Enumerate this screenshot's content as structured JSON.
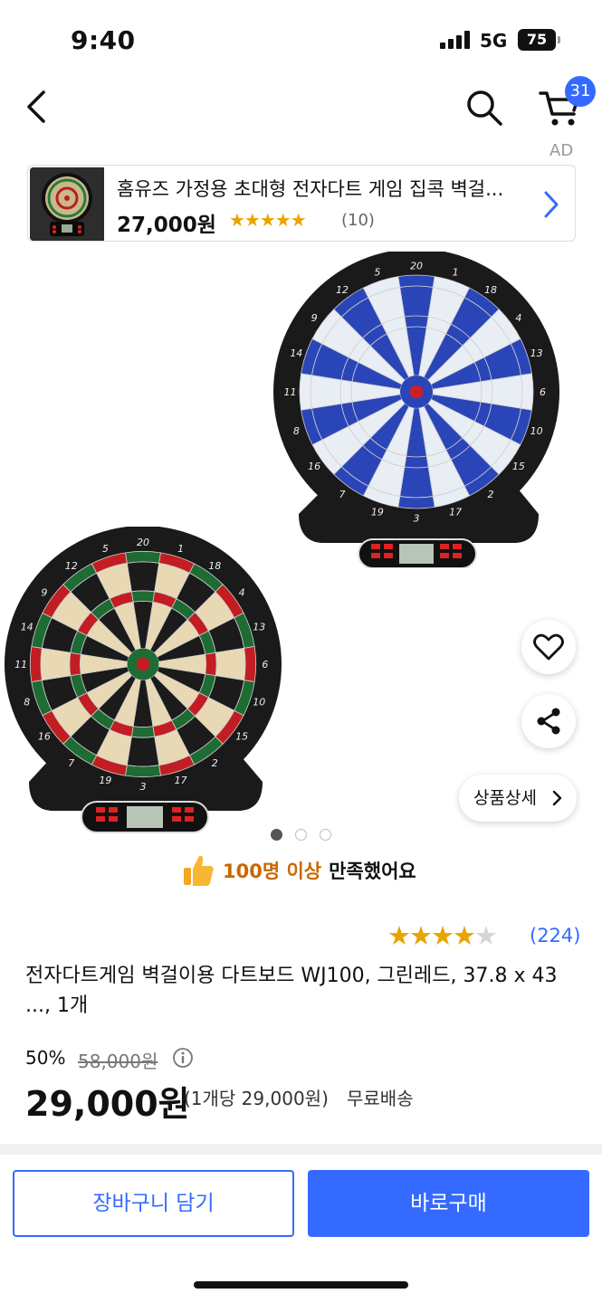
{
  "status_bar": {
    "time": "9:40",
    "network": "5G",
    "battery": "75"
  },
  "header": {
    "cart_count": "31"
  },
  "ad": {
    "label": "AD",
    "title": "홈유즈 가정용 초대형 전자다트 게임 집콕 벽걸...",
    "price": "27,000원",
    "stars": "★★★★★",
    "rating": 4.5,
    "review_count": "(10)"
  },
  "gallery": {
    "current_page": 1,
    "total_pages": 3,
    "detail_button": "상품상세"
  },
  "satisfaction": {
    "highlight": "100명 이상",
    "text": "만족했어요"
  },
  "product": {
    "stars": "★★★★★",
    "rating": 4,
    "review_count": "(224)",
    "title": "전자다트게임 벽걸이용 다트보드 WJ100, 그린레드, 37.8 x 43 ..., 1개",
    "discount": "50%",
    "original_price": "58,000원",
    "price": "29,000원",
    "unit_price": "(1개당 29,000원)",
    "shipping": "무료배송"
  },
  "actions": {
    "add_to_cart": "장바구니 담기",
    "buy_now": "바로구매"
  },
  "colors": {
    "accent": "#346aff",
    "star": "#e8a400",
    "highlight": "#c96800"
  },
  "icons": [
    "back-icon",
    "search-icon",
    "cart-icon",
    "heart-icon",
    "share-icon",
    "info-icon",
    "thumbs-up-icon",
    "chevron-right-icon"
  ]
}
